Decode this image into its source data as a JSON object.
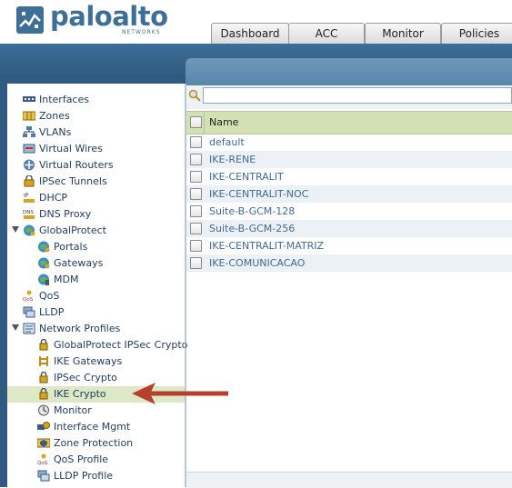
{
  "brand": {
    "name": "paloalto",
    "sub": "NETWORKS"
  },
  "tabs": [
    {
      "label": "Dashboard"
    },
    {
      "label": "ACC"
    },
    {
      "label": "Monitor"
    },
    {
      "label": "Policies"
    }
  ],
  "tree": {
    "items": [
      {
        "label": "Interfaces",
        "icon": "interfaces-icon"
      },
      {
        "label": "Zones",
        "icon": "zones-icon"
      },
      {
        "label": "VLANs",
        "icon": "vlans-icon"
      },
      {
        "label": "Virtual Wires",
        "icon": "virtual-wires-icon"
      },
      {
        "label": "Virtual Routers",
        "icon": "virtual-routers-icon"
      },
      {
        "label": "IPSec Tunnels",
        "icon": "ipsec-tunnels-icon"
      },
      {
        "label": "DHCP",
        "icon": "dhcp-icon"
      },
      {
        "label": "DNS Proxy",
        "icon": "dns-proxy-icon"
      },
      {
        "label": "GlobalProtect",
        "icon": "globalprotect-icon"
      },
      {
        "label": "Portals",
        "icon": "portals-icon"
      },
      {
        "label": "Gateways",
        "icon": "gateways-icon"
      },
      {
        "label": "MDM",
        "icon": "mdm-icon"
      },
      {
        "label": "QoS",
        "icon": "qos-icon"
      },
      {
        "label": "LLDP",
        "icon": "lldp-icon"
      },
      {
        "label": "Network Profiles",
        "icon": "network-profiles-icon"
      },
      {
        "label": "GlobalProtect IPSec Crypto",
        "icon": "lock-icon"
      },
      {
        "label": "IKE Gateways",
        "icon": "ike-gateways-icon"
      },
      {
        "label": "IPSec Crypto",
        "icon": "lock-icon"
      },
      {
        "label": "IKE Crypto",
        "icon": "lock-icon"
      },
      {
        "label": "Monitor",
        "icon": "monitor-icon"
      },
      {
        "label": "Interface Mgmt",
        "icon": "interface-mgmt-icon"
      },
      {
        "label": "Zone Protection",
        "icon": "zone-protection-icon"
      },
      {
        "label": "QoS Profile",
        "icon": "qos-profile-icon"
      },
      {
        "label": "LLDP Profile",
        "icon": "lldp-profile-icon"
      }
    ],
    "selected": "IKE Crypto"
  },
  "grid": {
    "column_name": "Name",
    "rows": [
      "default",
      "IKE-RENE",
      "IKE-CENTRALIT",
      "IKE-CENTRALIT-NOC",
      "Suite-B-GCM-128",
      "Suite-B-GCM-256",
      "IKE-CENTRALIT-MATRIZ",
      "IKE-COMUNICACAO"
    ]
  },
  "search": {
    "value": "",
    "placeholder": ""
  },
  "colors": {
    "brand_blue": "#3e6f97",
    "nav_band": "#3c6e97",
    "selected_row": "#dce8c6",
    "header_green": "#d3e0b4",
    "link_blue": "#3e6a96",
    "arrow_red": "#b5412d"
  }
}
